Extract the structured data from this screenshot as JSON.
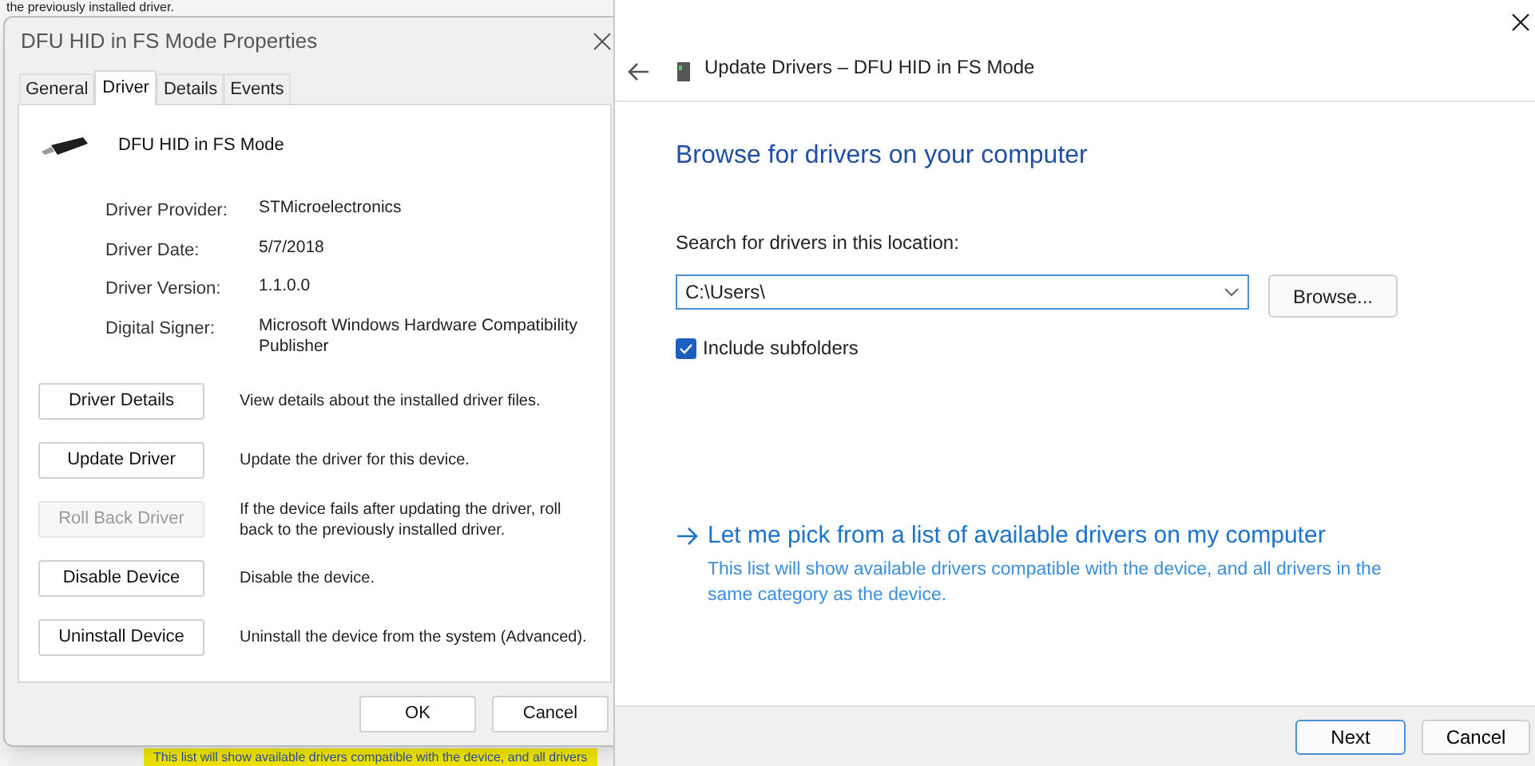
{
  "background_window": {
    "top_lines": [
      "the previously installed driver."
    ],
    "highlighted_text": "This list will show available drivers compatible with the device, and all drivers"
  },
  "properties_dialog": {
    "title": "DFU HID in FS Mode Properties",
    "tabs": [
      {
        "label": "General",
        "selected": false
      },
      {
        "label": "Driver",
        "selected": true
      },
      {
        "label": "Details",
        "selected": false
      },
      {
        "label": "Events",
        "selected": false
      }
    ],
    "device_name": "DFU HID in FS Mode",
    "fields": [
      {
        "label": "Driver Provider:",
        "value": "STMicroelectronics"
      },
      {
        "label": "Driver Date:",
        "value": "5/7/2018"
      },
      {
        "label": "Driver Version:",
        "value": "1.1.0.0"
      },
      {
        "label": "Digital Signer:",
        "value": "Microsoft Windows Hardware Compatibility Publisher"
      }
    ],
    "actions": [
      {
        "button": "Driver Details",
        "description": "View details about the installed driver files.",
        "disabled": false
      },
      {
        "button": "Update Driver",
        "description": "Update the driver for this device.",
        "disabled": false
      },
      {
        "button": "Roll Back Driver",
        "description": "If the device fails after updating the driver, roll back to the previously installed driver.",
        "disabled": true
      },
      {
        "button": "Disable Device",
        "description": "Disable the device.",
        "disabled": false
      },
      {
        "button": "Uninstall Device",
        "description": "Uninstall the device from the system (Advanced).",
        "disabled": false
      }
    ],
    "buttons": [
      "OK",
      "Cancel"
    ]
  },
  "update_drivers": {
    "title": "Update Drivers – DFU HID in FS Mode",
    "heading": "Browse for drivers on your computer",
    "location_label": "Search for drivers in this location:",
    "location_value": "C:\\Users\\",
    "browse_button": "Browse...",
    "include_subfolders": {
      "label": "Include subfolders",
      "checked": true
    },
    "pick_link": "Let me pick from a list of available drivers on my computer",
    "pick_description": "This list will show available drivers compatible with the device, and all drivers in the same category as the device.",
    "buttons": [
      "Next",
      "Cancel"
    ]
  }
}
